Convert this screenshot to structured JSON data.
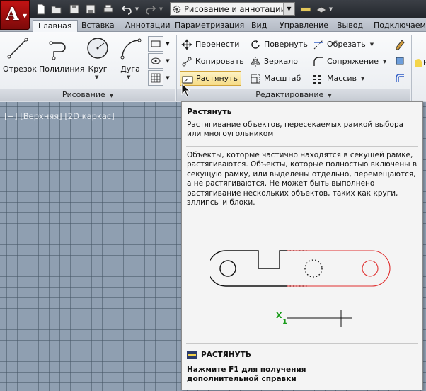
{
  "colors": {
    "accent": "#c31313",
    "ribbon_bg": "#f4f6f9",
    "viewport": "#8f9fb1",
    "selected": "#f6dc86"
  },
  "app": {
    "logo": "A",
    "icon": "autocad-app-icon"
  },
  "qat": {
    "workspace": "Рисование и аннотации",
    "icons": [
      "new-file-icon",
      "open-folder-icon",
      "save-icon",
      "save-as-icon",
      "print-icon",
      "undo-icon",
      "redo-icon",
      "gear-icon",
      "measure-icon",
      "layer-icon"
    ]
  },
  "tabs": [
    "Главная",
    "Вставка",
    "Аннотации",
    "Параметризация",
    "Вид",
    "Управление",
    "Вывод",
    "Подключаемы"
  ],
  "draw": {
    "tools": [
      "Отрезок",
      "Полилиния",
      "Круг",
      "Дуга"
    ],
    "group": "Рисование"
  },
  "modify": {
    "move": "Перенести",
    "copy": "Копировать",
    "stretch": "Растянуть",
    "rotate": "Повернуть",
    "mirror": "Зеркало",
    "scale": "Масштаб",
    "trim": "Обрезать",
    "fillet": "Сопряжение",
    "array": "Массив",
    "group": "Редактирование"
  },
  "right_partial": "Не",
  "viewport": {
    "label": "[−] [Верхняя] [2D каркас]"
  },
  "tooltip": {
    "title": "Растянуть",
    "summary": "Растягивание объектов, пересекаемых рамкой выбора или многоугольником",
    "detail": "Объекты, которые частично находятся в секущей рамке, растягиваются. Объекты, которые полностью включены в секущую рамку, или выделены отдельно, перемещаются, а не растягиваются. Не может быть выполнено растягивание нескольких объектов, таких как круги, эллипсы и блоки.",
    "axis_x": "X",
    "axis_sub": "1",
    "command": "РАСТЯНУТЬ",
    "help": "Нажмите F1 для получения дополнительной справки"
  }
}
